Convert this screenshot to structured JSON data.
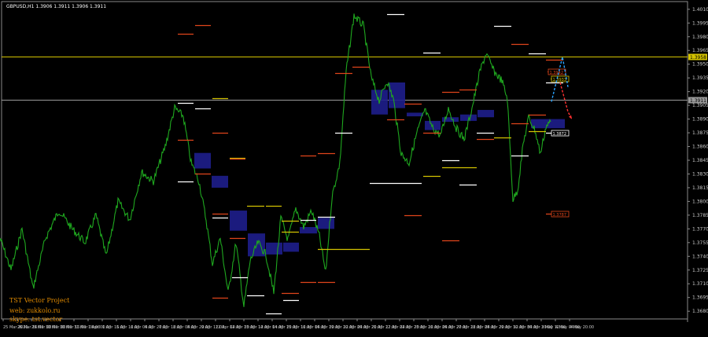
{
  "header": {
    "symbol_info": "GBPUSD,H1  1.3906 1.3911 1.3906 1.3911"
  },
  "watermark": {
    "line1": "TST Vector Project",
    "line2": "web: zukkolo.ru",
    "line3": "skype: tst.vector"
  },
  "colors": {
    "background": "#000000",
    "price_line": "#1fa81f",
    "frame": "#8a8a8a",
    "yellow_line": "#d4c300",
    "gray_line": "#9a9a9a",
    "zone_fill": "#1e1e8c",
    "level_red": "#e0451b",
    "level_yellow": "#d4c300",
    "level_white": "#ffffff",
    "forecast_blue": "#29a3ff",
    "forecast_red": "#ff3030"
  },
  "chart_data": {
    "type": "line",
    "symbol": "GBPUSD",
    "timeframe": "H1",
    "ylim": [
      1.3675,
      1.4015
    ],
    "y_ticks": [
      "1.4010",
      "1.3995",
      "1.3980",
      "1.3965",
      "1.3950",
      "1.3935",
      "1.3920",
      "1.3905",
      "1.3890",
      "1.3875",
      "1.3860",
      "1.3845",
      "1.3830",
      "1.3815",
      "1.3800",
      "1.3785",
      "1.3770",
      "1.3755",
      "1.3740",
      "1.3725",
      "1.3710",
      "1.3695",
      "1.3680"
    ],
    "x_ticks": [
      "25 Mar 2021",
      "26 Mar 16:00",
      "29 Mar 08:00",
      "30 Mar 00:00",
      "30 Mar 16:00",
      "31 Mar 08:00",
      "1 Apr 00:00",
      "1 Apr 16:00",
      "5 Apr 12:00",
      "6 Apr 04:00",
      "6 Apr 20:00",
      "7 Apr 12:00",
      "8 Apr 04:00",
      "8 Apr 20:00",
      "9 Apr 12:00",
      "12 Apr 04:00",
      "12 Apr 20:00",
      "13 Apr 12:00",
      "14 Apr 04:00",
      "14 Apr 20:00",
      "15 Apr 12:00",
      "16 Apr 04:00",
      "16 Apr 20:00",
      "19 Apr 12:00",
      "20 Apr 04:00",
      "20 Apr 20:00",
      "21 Apr 12:00",
      "22 Apr 04:00",
      "22 Apr 20:00",
      "23 Apr 12:00",
      "26 Apr 04:00",
      "26 Apr 20:00",
      "27 Apr 12:00",
      "28 Apr 04:00",
      "28 Apr 20:00",
      "29 Apr 12:00",
      "30 Apr 04:00",
      "30 Apr 20:00",
      "3 May 12:00",
      "4 May 04:00",
      "4 May 20:00"
    ],
    "price_path": [
      [
        0,
        1.376
      ],
      [
        14,
        1.3725
      ],
      [
        28,
        1.377
      ],
      [
        42,
        1.3705
      ],
      [
        58,
        1.376
      ],
      [
        75,
        1.379
      ],
      [
        92,
        1.377
      ],
      [
        108,
        1.3755
      ],
      [
        122,
        1.3785
      ],
      [
        135,
        1.374
      ],
      [
        150,
        1.38
      ],
      [
        165,
        1.378
      ],
      [
        180,
        1.3832
      ],
      [
        195,
        1.3822
      ],
      [
        210,
        1.386
      ],
      [
        222,
        1.3902
      ],
      [
        233,
        1.3893
      ],
      [
        243,
        1.3842
      ],
      [
        253,
        1.3822
      ],
      [
        262,
        1.378
      ],
      [
        270,
        1.3732
      ],
      [
        280,
        1.376
      ],
      [
        290,
        1.37
      ],
      [
        300,
        1.3755
      ],
      [
        310,
        1.3685
      ],
      [
        318,
        1.3735
      ],
      [
        328,
        1.3755
      ],
      [
        338,
        1.3742
      ],
      [
        348,
        1.37
      ],
      [
        357,
        1.3782
      ],
      [
        366,
        1.3758
      ],
      [
        376,
        1.3792
      ],
      [
        386,
        1.3772
      ],
      [
        396,
        1.379
      ],
      [
        406,
        1.3762
      ],
      [
        414,
        1.3722
      ],
      [
        422,
        1.3805
      ],
      [
        432,
        1.3842
      ],
      [
        440,
        1.3942
      ],
      [
        450,
        1.4003
      ],
      [
        462,
        1.3992
      ],
      [
        472,
        1.3935
      ],
      [
        482,
        1.391
      ],
      [
        492,
        1.3932
      ],
      [
        500,
        1.3912
      ],
      [
        510,
        1.3852
      ],
      [
        520,
        1.3842
      ],
      [
        530,
        1.3875
      ],
      [
        540,
        1.39
      ],
      [
        550,
        1.388
      ],
      [
        560,
        1.3872
      ],
      [
        570,
        1.3902
      ],
      [
        580,
        1.388
      ],
      [
        590,
        1.3868
      ],
      [
        600,
        1.3902
      ],
      [
        610,
        1.3942
      ],
      [
        618,
        1.3962
      ],
      [
        628,
        1.3942
      ],
      [
        638,
        1.3932
      ],
      [
        645,
        1.3912
      ],
      [
        652,
        1.3802
      ],
      [
        658,
        1.3812
      ],
      [
        665,
        1.3862
      ],
      [
        672,
        1.3892
      ],
      [
        680,
        1.3878
      ],
      [
        687,
        1.3852
      ],
      [
        694,
        1.3882
      ],
      [
        700,
        1.3887
      ]
    ],
    "horizontal_lines": [
      {
        "price": 1.3958,
        "label": "1.3958",
        "color": "yellow_line"
      },
      {
        "price": 1.3911,
        "label": "1.3911",
        "color": "gray_line"
      }
    ],
    "zones": [
      {
        "x0": 247,
        "x1": 268,
        "top": 1.3853,
        "bottom": 1.3836
      },
      {
        "x0": 269,
        "x1": 290,
        "top": 1.3828,
        "bottom": 1.3815
      },
      {
        "x0": 292,
        "x1": 314,
        "top": 1.379,
        "bottom": 1.3768
      },
      {
        "x0": 315,
        "x1": 337,
        "top": 1.3765,
        "bottom": 1.374
      },
      {
        "x0": 338,
        "x1": 359,
        "top": 1.3755,
        "bottom": 1.3742
      },
      {
        "x0": 360,
        "x1": 380,
        "top": 1.3755,
        "bottom": 1.3745
      },
      {
        "x0": 381,
        "x1": 403,
        "top": 1.3772,
        "bottom": 1.3765
      },
      {
        "x0": 404,
        "x1": 425,
        "top": 1.3782,
        "bottom": 1.377
      },
      {
        "x0": 472,
        "x1": 493,
        "top": 1.3922,
        "bottom": 1.3895
      },
      {
        "x0": 494,
        "x1": 515,
        "top": 1.393,
        "bottom": 1.3902
      },
      {
        "x0": 517,
        "x1": 538,
        "top": 1.3897,
        "bottom": 1.3893
      },
      {
        "x0": 540,
        "x1": 560,
        "top": 1.3888,
        "bottom": 1.3878
      },
      {
        "x0": 562,
        "x1": 583,
        "top": 1.3892,
        "bottom": 1.3887
      },
      {
        "x0": 585,
        "x1": 606,
        "top": 1.3895,
        "bottom": 1.3888
      },
      {
        "x0": 607,
        "x1": 628,
        "top": 1.39,
        "bottom": 1.3892
      },
      {
        "x0": 675,
        "x1": 718,
        "top": 1.389,
        "bottom": 1.388
      }
    ],
    "levels": [
      {
        "x0": 226,
        "x1": 246,
        "p": 1.3983,
        "c": "level_red"
      },
      {
        "x0": 248,
        "x1": 268,
        "p": 1.3993,
        "c": "level_red"
      },
      {
        "x0": 226,
        "x1": 246,
        "p": 1.3867,
        "c": "level_red"
      },
      {
        "x0": 226,
        "x1": 246,
        "p": 1.3908,
        "c": "level_white"
      },
      {
        "x0": 248,
        "x1": 268,
        "p": 1.3902,
        "c": "level_white"
      },
      {
        "x0": 270,
        "x1": 290,
        "p": 1.3913,
        "c": "level_yellow"
      },
      {
        "x0": 270,
        "x1": 290,
        "p": 1.3875,
        "c": "level_red"
      },
      {
        "x0": 226,
        "x1": 246,
        "p": 1.3822,
        "c": "level_white"
      },
      {
        "x0": 248,
        "x1": 268,
        "p": 1.383,
        "c": "level_red"
      },
      {
        "x0": 270,
        "x1": 290,
        "p": 1.3787,
        "c": "level_red"
      },
      {
        "x0": 292,
        "x1": 312,
        "p": 1.3848,
        "c": "level_yellow"
      },
      {
        "x0": 292,
        "x1": 312,
        "p": 1.3847,
        "c": "level_red"
      },
      {
        "x0": 270,
        "x1": 290,
        "p": 1.3782,
        "c": "level_white"
      },
      {
        "x0": 292,
        "x1": 312,
        "p": 1.376,
        "c": "level_red"
      },
      {
        "x0": 314,
        "x1": 336,
        "p": 1.3795,
        "c": "level_yellow"
      },
      {
        "x0": 338,
        "x1": 358,
        "p": 1.3795,
        "c": "level_yellow"
      },
      {
        "x0": 295,
        "x1": 315,
        "p": 1.3717,
        "c": "level_white"
      },
      {
        "x0": 270,
        "x1": 290,
        "p": 1.3695,
        "c": "level_red"
      },
      {
        "x0": 314,
        "x1": 336,
        "p": 1.3697,
        "c": "level_white"
      },
      {
        "x0": 338,
        "x1": 358,
        "p": 1.3678,
        "c": "level_white"
      },
      {
        "x0": 358,
        "x1": 380,
        "p": 1.3767,
        "c": "level_yellow"
      },
      {
        "x0": 358,
        "x1": 380,
        "p": 1.3779,
        "c": "level_yellow"
      },
      {
        "x0": 358,
        "x1": 380,
        "p": 1.37,
        "c": "level_red"
      },
      {
        "x0": 360,
        "x1": 380,
        "p": 1.3692,
        "c": "level_white"
      },
      {
        "x0": 382,
        "x1": 402,
        "p": 1.385,
        "c": "level_red"
      },
      {
        "x0": 382,
        "x1": 402,
        "p": 1.378,
        "c": "level_white"
      },
      {
        "x0": 382,
        "x1": 402,
        "p": 1.3712,
        "c": "level_red"
      },
      {
        "x0": 404,
        "x1": 426,
        "p": 1.3783,
        "c": "level_white"
      },
      {
        "x0": 404,
        "x1": 426,
        "p": 1.3853,
        "c": "level_red"
      },
      {
        "x0": 404,
        "x1": 426,
        "p": 1.3748,
        "c": "level_yellow"
      },
      {
        "x0": 404,
        "x1": 426,
        "p": 1.3712,
        "c": "level_red"
      },
      {
        "x0": 426,
        "x1": 448,
        "p": 1.3748,
        "c": "level_yellow"
      },
      {
        "x0": 448,
        "x1": 470,
        "p": 1.3748,
        "c": "level_yellow"
      },
      {
        "x0": 426,
        "x1": 448,
        "p": 1.3875,
        "c": "level_white"
      },
      {
        "x0": 426,
        "x1": 448,
        "p": 1.394,
        "c": "level_red"
      },
      {
        "x0": 448,
        "x1": 470,
        "p": 1.3947,
        "c": "level_red"
      },
      {
        "x0": 470,
        "x1": 492,
        "p": 1.382,
        "c": "level_white"
      },
      {
        "x0": 492,
        "x1": 514,
        "p": 1.382,
        "c": "level_white"
      },
      {
        "x0": 492,
        "x1": 514,
        "p": 1.4005,
        "c": "level_white"
      },
      {
        "x0": 492,
        "x1": 514,
        "p": 1.389,
        "c": "level_red"
      },
      {
        "x0": 514,
        "x1": 536,
        "p": 1.382,
        "c": "level_white"
      },
      {
        "x0": 514,
        "x1": 536,
        "p": 1.3907,
        "c": "level_red"
      },
      {
        "x0": 514,
        "x1": 536,
        "p": 1.3785,
        "c": "level_red"
      },
      {
        "x0": 538,
        "x1": 560,
        "p": 1.3963,
        "c": "level_white"
      },
      {
        "x0": 538,
        "x1": 560,
        "p": 1.3875,
        "c": "level_red"
      },
      {
        "x0": 538,
        "x1": 560,
        "p": 1.3828,
        "c": "level_yellow"
      },
      {
        "x0": 562,
        "x1": 584,
        "p": 1.3845,
        "c": "level_white"
      },
      {
        "x0": 562,
        "x1": 584,
        "p": 1.3837,
        "c": "level_yellow"
      },
      {
        "x0": 562,
        "x1": 584,
        "p": 1.392,
        "c": "level_red"
      },
      {
        "x0": 562,
        "x1": 584,
        "p": 1.3757,
        "c": "level_red"
      },
      {
        "x0": 584,
        "x1": 606,
        "p": 1.3837,
        "c": "level_yellow"
      },
      {
        "x0": 584,
        "x1": 606,
        "p": 1.3818,
        "c": "level_white"
      },
      {
        "x0": 584,
        "x1": 606,
        "p": 1.3922,
        "c": "level_red"
      },
      {
        "x0": 606,
        "x1": 628,
        "p": 1.3875,
        "c": "level_white"
      },
      {
        "x0": 606,
        "x1": 628,
        "p": 1.3868,
        "c": "level_red"
      },
      {
        "x0": 628,
        "x1": 650,
        "p": 1.387,
        "c": "level_yellow"
      },
      {
        "x0": 628,
        "x1": 650,
        "p": 1.3992,
        "c": "level_white"
      },
      {
        "x0": 650,
        "x1": 672,
        "p": 1.3885,
        "c": "level_red"
      },
      {
        "x0": 650,
        "x1": 672,
        "p": 1.3972,
        "c": "level_red"
      },
      {
        "x0": 650,
        "x1": 672,
        "p": 1.385,
        "c": "level_white"
      },
      {
        "x0": 672,
        "x1": 694,
        "p": 1.3962,
        "c": "level_white"
      },
      {
        "x0": 672,
        "x1": 694,
        "p": 1.3877,
        "c": "level_yellow"
      },
      {
        "x0": 672,
        "x1": 694,
        "p": 1.3895,
        "c": "level_red"
      },
      {
        "x0": 694,
        "x1": 716,
        "p": 1.3955,
        "c": "level_red"
      },
      {
        "x0": 694,
        "x1": 716,
        "p": 1.393,
        "c": "level_white"
      },
      {
        "x0": 694,
        "x1": 716,
        "p": 1.3875,
        "c": "level_white"
      },
      {
        "x0": 694,
        "x1": 716,
        "p": 1.3787,
        "c": "level_red"
      }
    ],
    "labeled_levels": [
      {
        "x0": 696,
        "x1": 719,
        "p": 1.3942,
        "label": "1.3942",
        "c": "level_red"
      },
      {
        "x0": 700,
        "x1": 723,
        "p": 1.3934,
        "label": "1.3933",
        "c": "level_yellow"
      },
      {
        "x0": 700,
        "x1": 723,
        "p": 1.3875,
        "label": "1.3872",
        "c": "level_white"
      },
      {
        "x0": 700,
        "x1": 723,
        "p": 1.3787,
        "label": "1.3787",
        "c": "level_red"
      }
    ],
    "forecast": {
      "blue": [
        [
          701,
          1.3909
        ],
        [
          715,
          1.3958
        ],
        [
          722,
          1.3925
        ]
      ],
      "red": [
        [
          712,
          1.393
        ],
        [
          722,
          1.3898
        ],
        [
          727,
          1.389
        ]
      ]
    }
  }
}
